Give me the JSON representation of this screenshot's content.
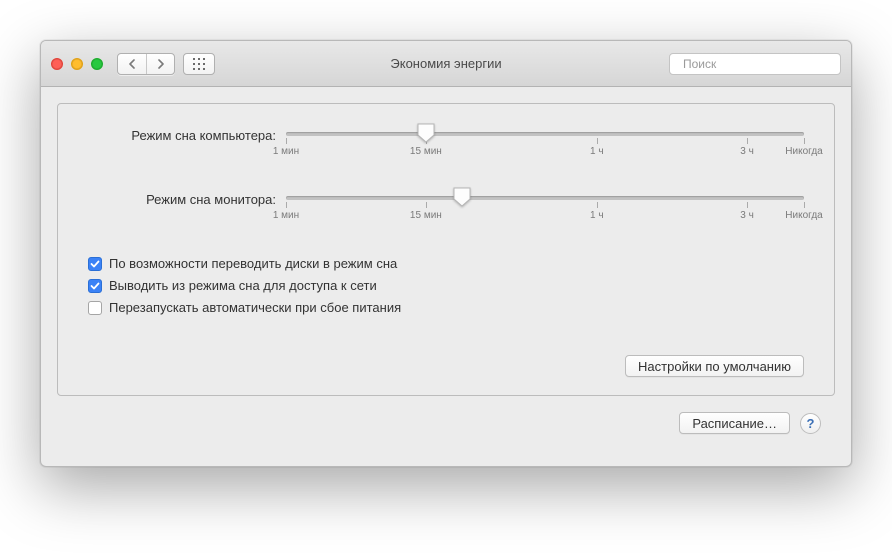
{
  "window": {
    "title": "Экономия энергии"
  },
  "toolbar": {
    "search_placeholder": "Поиск"
  },
  "sliders": {
    "computer": {
      "label": "Режим сна компьютера:",
      "thumb_pos_pct": 27
    },
    "display": {
      "label": "Режим сна монитора:",
      "thumb_pos_pct": 34
    },
    "ticks": {
      "t1": {
        "pos": 0,
        "label": "1 мин"
      },
      "t15": {
        "pos": 27,
        "label": "15 мин"
      },
      "t1h": {
        "pos": 60,
        "label": "1 ч"
      },
      "t3h": {
        "pos": 89,
        "label": "3 ч"
      },
      "never": {
        "pos": 100,
        "label": "Никогда"
      }
    }
  },
  "options": {
    "disk_sleep": {
      "label": "По возможности переводить диски в режим сна",
      "checked": true
    },
    "wake_network": {
      "label": "Выводить из режима сна для доступа к сети",
      "checked": true
    },
    "auto_restart": {
      "label": "Перезапускать автоматически при сбое питания",
      "checked": false
    }
  },
  "buttons": {
    "defaults": "Настройки по умолчанию",
    "schedule": "Расписание…",
    "help": "?"
  }
}
